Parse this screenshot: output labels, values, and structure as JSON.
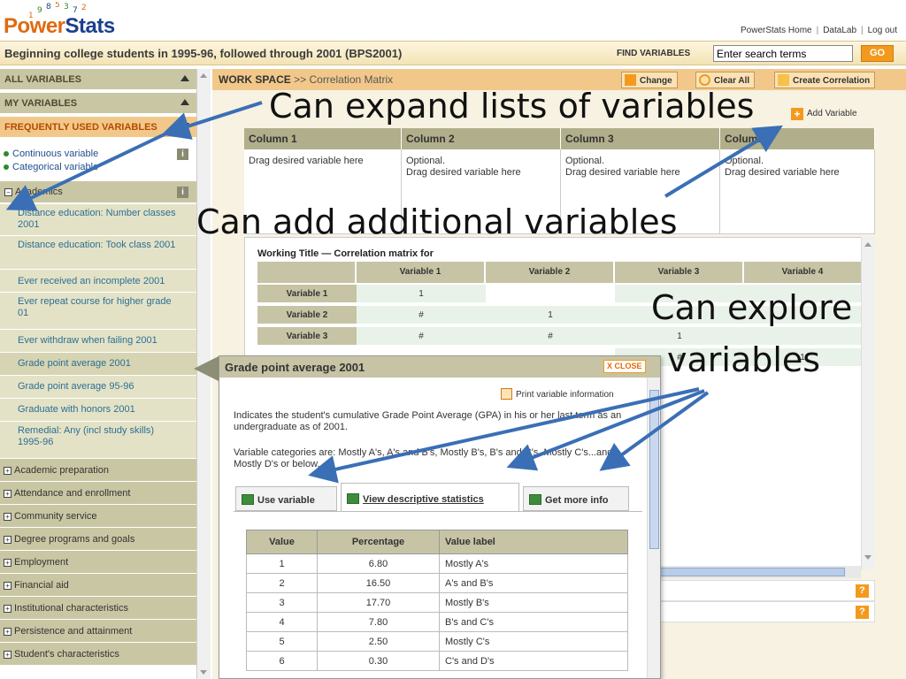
{
  "app": {
    "logo_text_orange": "Power",
    "logo_text_blue": "Stats"
  },
  "top_links": [
    "PowerStats Home",
    "DataLab",
    "Log out"
  ],
  "header": {
    "study_title": "Beginning college students in 1995-96, followed through 2001 (BPS2001)",
    "find_label": "FIND VARIABLES",
    "search_placeholder": "Enter search terms",
    "search_value": "Enter search terms",
    "go_label": "GO"
  },
  "sidebar": {
    "all_variables": "ALL VARIABLES",
    "my_variables": "MY VARIABLES",
    "frequently_used": "FREQUENTLY USED VARIABLES",
    "legend_continuous": "Continuous variable",
    "legend_categorical": "Categorical variable",
    "info_glyph": "i",
    "open_category": "Academics",
    "items": [
      "Distance education: Number classes 2001",
      "Distance education: Took class 2001",
      "Ever received an incomplete 2001",
      "Ever repeat course for higher grade 01",
      "Ever withdraw when failing 2001",
      "Grade point average 2001",
      "Grade point average 95-96",
      "Graduate with honors 2001",
      "Remedial: Any (incl study skills) 1995-96"
    ],
    "categories": [
      "Academic preparation",
      "Attendance and enrollment",
      "Community service",
      "Degree programs and goals",
      "Employment",
      "Financial aid",
      "Institutional characteristics",
      "Persistence and attainment",
      "Student's characteristics"
    ]
  },
  "workspace": {
    "title": "WORK SPACE",
    "crumb": ">> Correlation Matrix",
    "buttons": {
      "change": "Change",
      "clear_all": "Clear All",
      "create": "Create Correlation"
    },
    "add_variable": "Add Variable",
    "columns": [
      {
        "header": "Column 1",
        "line1": "Drag desired variable here",
        "line2": ""
      },
      {
        "header": "Column 2",
        "line1": "Optional.",
        "line2": "Drag desired variable here"
      },
      {
        "header": "Column 3",
        "line1": "Optional.",
        "line2": "Drag desired variable here"
      },
      {
        "header": "Column 4",
        "line1": "Optional.",
        "line2": "Drag desired variable here"
      }
    ],
    "matrix_title": "Working Title — Correlation matrix for",
    "matrix_headers": [
      "Variable 1",
      "Variable 2",
      "Variable 3",
      "Variable 4"
    ],
    "matrix_rows": [
      {
        "label": "Variable 1",
        "cells": [
          "1",
          "",
          "",
          ""
        ]
      },
      {
        "label": "Variable 2",
        "cells": [
          "#",
          "1",
          "",
          ""
        ]
      },
      {
        "label": "Variable 3",
        "cells": [
          "#",
          "#",
          "1",
          ""
        ]
      },
      {
        "label": "",
        "cells": [
          "",
          "",
          "#",
          "1"
        ]
      }
    ],
    "help_glyph": "?"
  },
  "popup": {
    "title": "Grade point average 2001",
    "close_label": "X CLOSE",
    "print_link": "Print variable information",
    "description": "Indicates the student's cumulative Grade Point Average (GPA) in his or her last term as an undergraduate as of 2001.",
    "categories_text": "Variable categories are: Mostly A's, A's and B's, Mostly B's, B's and C's, Mostly C's...and Mostly D's or below.",
    "tabs": [
      "Use variable",
      "View descriptive statistics",
      "Get more info"
    ],
    "table_headers": [
      "Value",
      "Percentage",
      "Value label"
    ],
    "table_rows": [
      [
        "1",
        "6.80",
        "Mostly A's"
      ],
      [
        "2",
        "16.50",
        "A's and B's"
      ],
      [
        "3",
        "17.70",
        "Mostly B's"
      ],
      [
        "4",
        "7.80",
        "B's and C's"
      ],
      [
        "5",
        "2.50",
        "Mostly C's"
      ],
      [
        "6",
        "0.30",
        "C's and D's"
      ]
    ]
  },
  "annotations": {
    "expand": "Can expand lists of variables",
    "add": "Can add additional variables",
    "explore_line1": "Can explore",
    "explore_line2": "variables"
  },
  "colors": {
    "accent_orange": "#f39a1e",
    "annotation_arrow": "#3a6fb5",
    "sidebar_header": "#c9c6a3",
    "sidebar_item": "#e4e2c6",
    "link_blue": "#2a6f96"
  }
}
